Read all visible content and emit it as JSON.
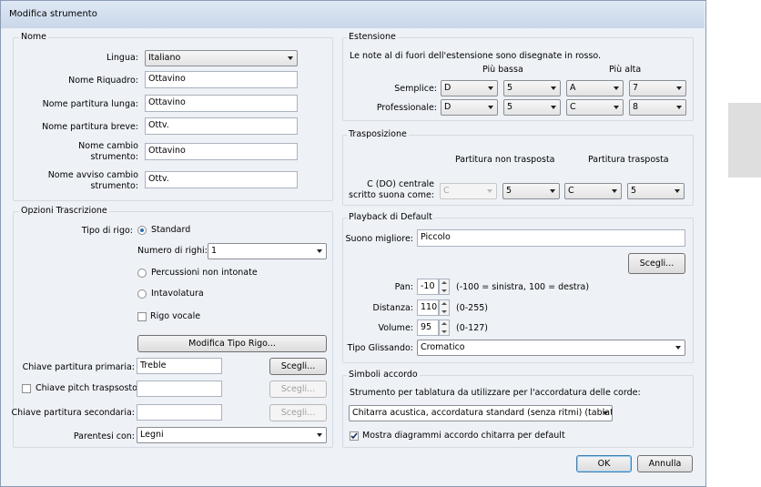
{
  "window": {
    "title": "Modifica strumento"
  },
  "nome": {
    "group_title": "Nome",
    "lingua_label": "Lingua:",
    "lingua_value": "Italiano",
    "riquadro_label": "Nome Riquadro:",
    "riquadro_value": "Ottavino",
    "lunga_label": "Nome partitura lunga:",
    "lunga_value": "Ottavino",
    "breve_label": "Nome partitura breve:",
    "breve_value": "Ottv.",
    "cambio_label_1": "Nome cambio",
    "cambio_label_2": "strumento:",
    "cambio_value": "Ottavino",
    "avviso_label_1": "Nome avviso cambio",
    "avviso_label_2": "strumento:",
    "avviso_value": "Ottv."
  },
  "trascrizione": {
    "group_title": "Opzioni Trascrizione",
    "tipo_rigo_label": "Tipo di rigo:",
    "standard_label": "Standard",
    "numero_righi_label": "Numero di righi:",
    "numero_righi_value": "1",
    "percussioni_label": "Percussioni non intonate",
    "intavolatura_label": "Intavolatura",
    "rigo_vocale_label": "Rigo vocale",
    "modifica_tipo_rigo": "Modifica Tipo Rigo...",
    "chiave_primaria_label": "Chiave partitura primaria:",
    "chiave_primaria_value": "Treble",
    "chiave_primaria_btn": "Scegli...",
    "chiave_pitch_label": "Chiave pitch traspsosto",
    "chiave_pitch_btn": "Scegli...",
    "chiave_secondaria_label": "Chiave partitura secondaria:",
    "chiave_secondaria_btn": "Scegli...",
    "parentesi_label": "Parentesi con:",
    "parentesi_value": "Legni"
  },
  "estensione": {
    "group_title": "Estensione",
    "note": "Le note al di fuori dell'estensione sono disegnate in rosso.",
    "bassa_label": "Più bassa",
    "alta_label": "Più alta",
    "semplice_label": "Semplice:",
    "semplice": [
      "D",
      "5",
      "A",
      "7"
    ],
    "professionale_label": "Professionale:",
    "professionale": [
      "D",
      "5",
      "C",
      "8"
    ]
  },
  "trasposizione": {
    "group_title": "Trasposizione",
    "non_trasposta_label": "Partitura non trasposta",
    "trasposta_label": "Partitura trasposta",
    "row_label_1": "C (DO) centrale",
    "row_label_2": "scritto suona come:",
    "values": [
      "C",
      "5",
      "C",
      "5"
    ]
  },
  "playback": {
    "group_title": "Playback di Default",
    "suono_label": "Suono migliore:",
    "suono_value": "Piccolo",
    "scegli_btn": "Scegli...",
    "pan_label": "Pan:",
    "pan_value": "-10",
    "pan_range": "(-100 = sinistra, 100 = destra)",
    "distanza_label": "Distanza:",
    "distanza_value": "110",
    "distanza_range": "(0-255)",
    "volume_label": "Volume:",
    "volume_value": "95",
    "volume_range": "(0-127)",
    "glissando_label": "Tipo Glissando:",
    "glissando_value": "Cromatico"
  },
  "accordo": {
    "group_title": "Simboli accordo",
    "strumento_label": "Strumento per tablatura da utilizzare per l'accordatura delle corde:",
    "strumento_value": "Chitarra acustica, accordatura standard (senza ritmi) (tablature",
    "mostra_label": "Mostra diagrammi accordo chitarra per default"
  },
  "buttons": {
    "ok": "OK",
    "annulla": "Annulla"
  }
}
